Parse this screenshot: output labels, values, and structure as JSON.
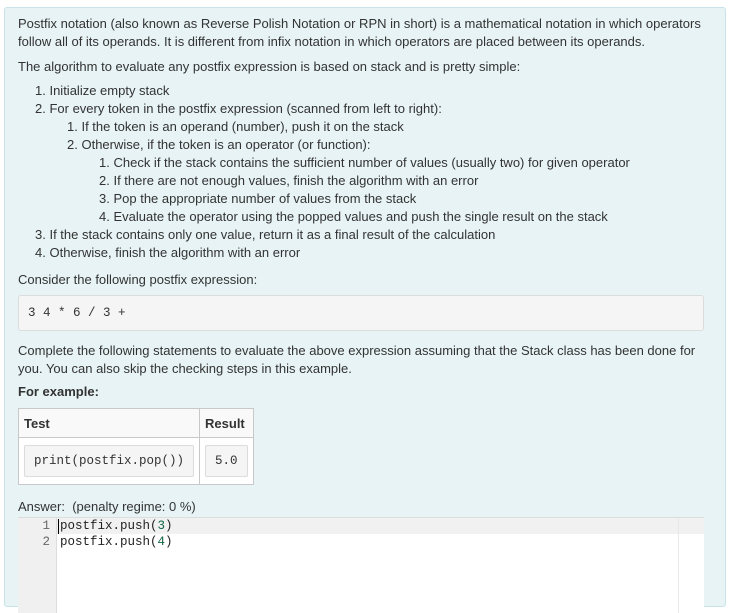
{
  "intro": {
    "line1": "Postfix notation (also known as Reverse Polish Notation or RPN in short) is a mathematical notation in which operators",
    "line2": "follow all of its operands. It is different from infix notation in which operators are placed between its operands."
  },
  "algorithm_intro": "The algorithm to evaluate any postfix expression is based on stack and is pretty simple:",
  "steps": [
    {
      "num": "1.",
      "text": "Initialize empty stack"
    },
    {
      "num": "2.",
      "text": "For every token in the postfix expression (scanned from left to right):"
    },
    {
      "num": "1.",
      "text": "If the token is an operand (number), push it on the stack"
    },
    {
      "num": "2.",
      "text": "Otherwise, if the token is an operator (or function):"
    },
    {
      "num": "1.",
      "text": "Check if the stack contains the sufficient number of values (usually two) for given operator"
    },
    {
      "num": "2.",
      "text": "If there are not enough values, finish the algorithm with an error"
    },
    {
      "num": "3.",
      "text": "Pop the appropriate number of values from the stack"
    },
    {
      "num": "4.",
      "text": "Evaluate the operator using the popped values and push the single result on the stack"
    },
    {
      "num": "3.",
      "text": "If the stack contains only one value, return it as a final result of the calculation"
    },
    {
      "num": "4.",
      "text": "Otherwise, finish the algorithm with an error"
    }
  ],
  "consider_text": "Consider the following postfix expression:",
  "expression": "3 4 * 6 / 3 +",
  "complete": {
    "line1": "Complete the following statements to evaluate the above expression assuming that the Stack class has been done for",
    "line2": "you. You can also skip the checking steps in this example."
  },
  "for_example": "For example:",
  "example_table": {
    "headers": [
      "Test",
      "Result"
    ],
    "rows": [
      {
        "test": "print(postfix.pop())",
        "result": "5.0"
      }
    ]
  },
  "answer_label": "Answer:",
  "penalty": "(penalty regime: 0 %)",
  "editor": {
    "lines": [
      {
        "num": "1",
        "call": "postfix.push(",
        "arg": "3",
        "close": ")"
      },
      {
        "num": "2",
        "call": "postfix.push(",
        "arg": "4",
        "close": ")"
      }
    ]
  }
}
